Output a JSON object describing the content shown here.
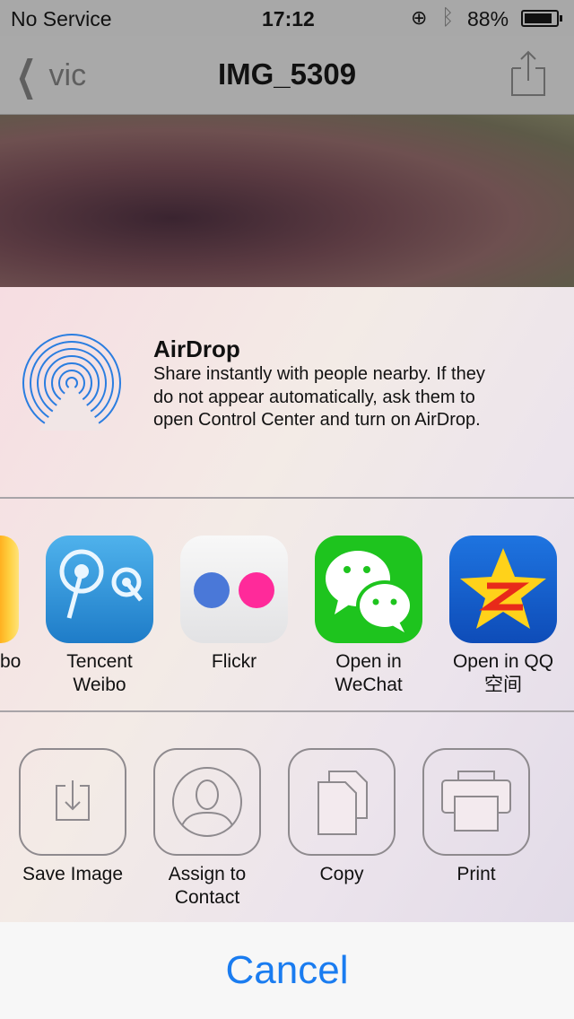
{
  "status": {
    "carrier": "No Service",
    "time": "17:12",
    "battery": "88%",
    "battery_level": 0.88
  },
  "nav": {
    "back": "vic",
    "title": "IMG_5309"
  },
  "airdrop": {
    "title": "AirDrop",
    "description_lines": [
      "Share instantly with people nearby. If they",
      "do not appear automatically, ask them to",
      "open Control Center and turn on AirDrop."
    ]
  },
  "apps": [
    {
      "label1": "Weibo",
      "label2": "",
      "visible_label": "bo"
    },
    {
      "label1": "Tencent",
      "label2": "Weibo"
    },
    {
      "label1": "Flickr",
      "label2": ""
    },
    {
      "label1": "Open in",
      "label2": "WeChat"
    },
    {
      "label1": "Open in QQ",
      "label2": "空间"
    }
  ],
  "actions": [
    {
      "label1": "Save Image",
      "label2": ""
    },
    {
      "label1": "Assign to",
      "label2": "Contact"
    },
    {
      "label1": "Copy",
      "label2": ""
    },
    {
      "label1": "Print",
      "label2": ""
    }
  ],
  "cancel": "Cancel",
  "colors": {
    "accent": "#1a7cf0",
    "wechat": "#1ec41e",
    "flickr_blue": "#4a78d8",
    "flickr_pink": "#ff2a9a",
    "qq_blue": "#1660d0"
  }
}
